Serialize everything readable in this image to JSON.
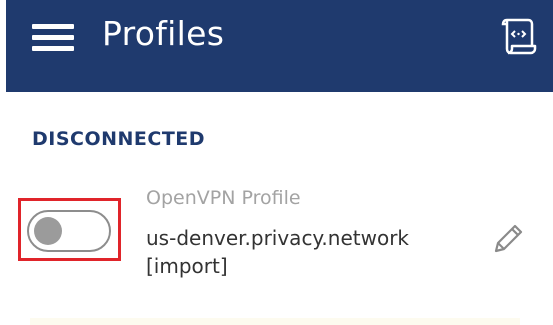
{
  "header": {
    "title": "Profiles",
    "menu_icon": "hamburger-menu-icon",
    "import_icon": "import-file-icon",
    "background_color": "#1f3a6e"
  },
  "section": {
    "status_label": "DISCONNECTED"
  },
  "profile": {
    "type_label": "OpenVPN Profile",
    "name": "us-denver.privacy.network [import]",
    "toggle_state": "off",
    "edit_icon": "pencil-icon",
    "highlight_color": "#e0242a"
  }
}
